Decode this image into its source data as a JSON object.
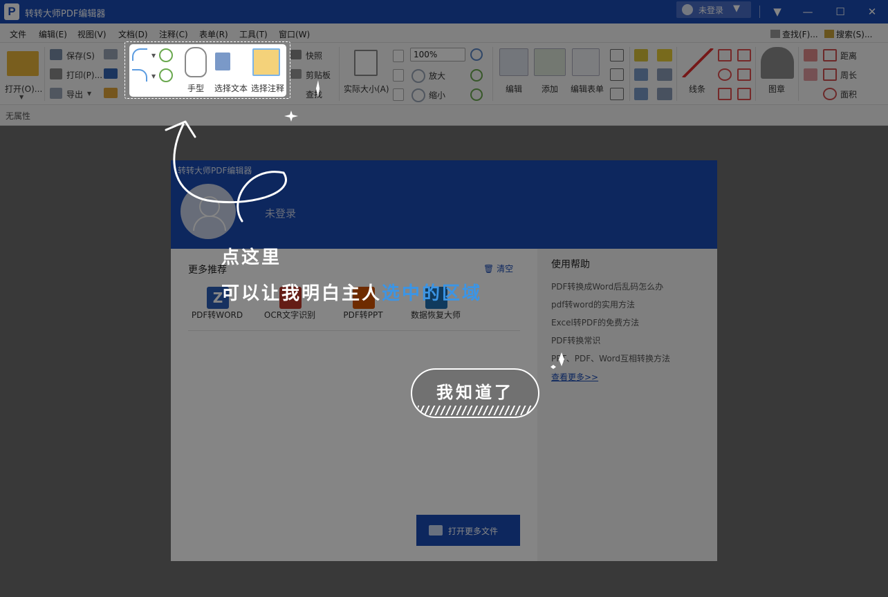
{
  "window": {
    "logo_letter": "P",
    "title": "转转大师PDF编辑器",
    "login": "未登录",
    "controls": {
      "dropdown": "▼",
      "minimize": "—",
      "maximize": "☐",
      "close": "✕"
    }
  },
  "menu": {
    "items": [
      "文件",
      "编辑(E)",
      "视图(V)",
      "文档(D)",
      "注释(C)",
      "表单(R)",
      "工具(T)",
      "窗口(W)"
    ],
    "find": "查找(F)...",
    "search": "搜索(S)..."
  },
  "ribbon": {
    "open": "打开(O)...",
    "save": "保存(S)",
    "print": "打印(P)...",
    "export": "导出",
    "hand": "手型",
    "select_text": "选择文本",
    "select_annot": "选择注释",
    "snapshot": "快照",
    "clipboard": "剪贴板",
    "find_partial": "查找",
    "actual_size": "实际大小(A)",
    "zoom_value": "100%",
    "zoom_in": "放大",
    "zoom_out": "缩小",
    "edit": "编辑",
    "add": "添加",
    "edit_form": "编辑表单",
    "lines": "线条",
    "stamp": "图章",
    "distance": "距离",
    "perimeter": "周长",
    "area": "面积"
  },
  "properties": {
    "label": "无属性"
  },
  "panel": {
    "title": "转转大师PDF编辑器",
    "login": "未登录",
    "recommend_title": "更多推荐",
    "clear": "清空",
    "cards": [
      {
        "label": "PDF转WORD",
        "icon": "word-icon",
        "glyph": "Z",
        "color": "#2b5fb8"
      },
      {
        "label": "OCR文字识别",
        "icon": "ocr-icon",
        "glyph": "",
        "color": "#c0392b"
      },
      {
        "label": "PDF转PPT",
        "icon": "ppt-icon",
        "glyph": "",
        "color": "#d35400"
      },
      {
        "label": "数据恢复大师",
        "icon": "recovery-icon",
        "glyph": "",
        "color": "#1f6fb2"
      }
    ],
    "open_more": "打开更多文件",
    "help_title": "使用帮助",
    "help_links": [
      "PDF转换成Word后乱码怎么办",
      "pdf转word的实用方法",
      "Excel转PDF的免费方法",
      "PDF转换常识",
      "PPT、PDF、Word互相转换方法"
    ],
    "see_more": "查看更多>>"
  },
  "tutorial": {
    "click_here": "点这里",
    "line_plain": "可以让我明白主人",
    "line_highlight": "选中的区域",
    "got_it": "我知道了"
  }
}
